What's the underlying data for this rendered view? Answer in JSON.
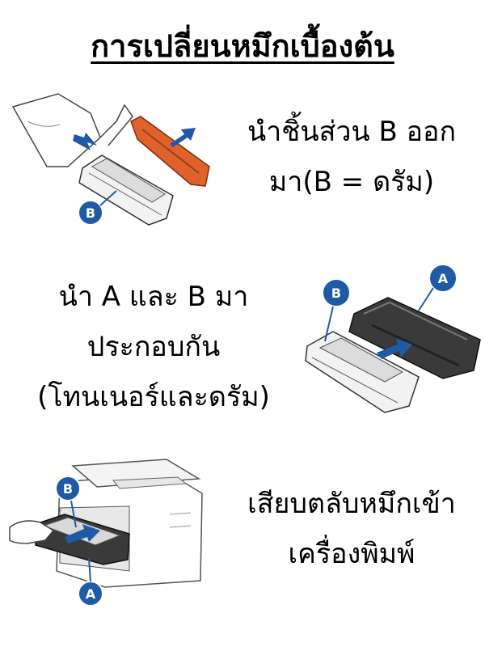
{
  "title": "การเปลี่ยนหมึกเบื้องต้น",
  "steps": [
    {
      "lines": [
        "นำชิ้นส่วน B ออก",
        "มา(B = ดรัม)"
      ]
    },
    {
      "lines": [
        "นำ A และ B มา",
        "ประกอบกัน",
        "(โทนเนอร์และดรัม)"
      ]
    },
    {
      "lines": [
        "เสียบตลับหมึกเข้า",
        "เครื่องพิมพ์"
      ]
    }
  ],
  "figures": {
    "unbox": {
      "badge": "B"
    },
    "assemble": {
      "badge_b": "B",
      "badge_a": "A"
    },
    "insert": {
      "badge_b": "B",
      "badge_a": "A"
    }
  },
  "colors": {
    "badge": "#1f5aa6",
    "arrow": "#1f5aa6",
    "orange_part": "#e0622a",
    "dark_part": "#3a3a3a"
  }
}
